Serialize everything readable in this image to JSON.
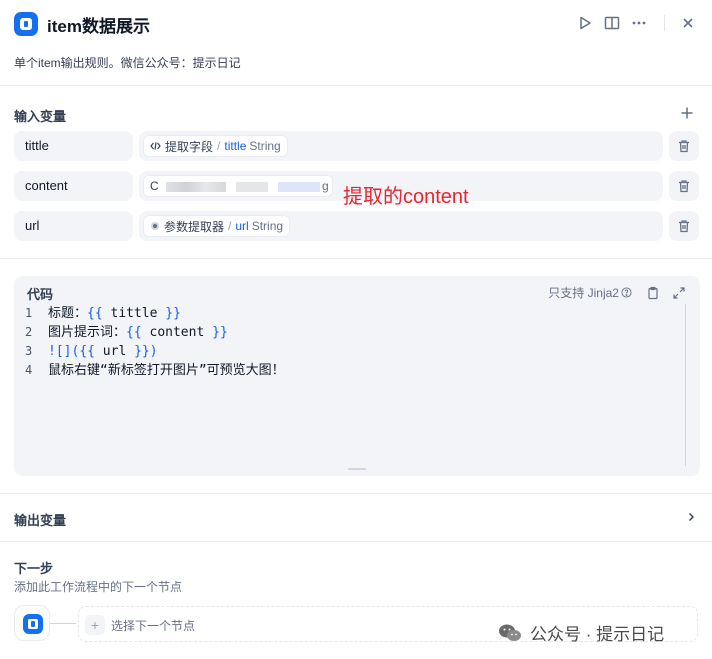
{
  "header": {
    "title": "item数据展示",
    "description": "单个item输出规则。微信公众号：提示日记"
  },
  "inputs": {
    "label": "输入变量",
    "rows": [
      {
        "name": "tittle",
        "source": "提取字段",
        "field": "tittle",
        "type": "String"
      },
      {
        "name": "content",
        "partial": "C",
        "partial_end": "g"
      },
      {
        "name": "url",
        "source": "参数提取器",
        "field": "url",
        "type": "String"
      }
    ],
    "annotation": "提取的content"
  },
  "code": {
    "label": "代码",
    "language_note": "只支持 Jinja2",
    "lines": [
      {
        "num": "1",
        "pre": "标题：",
        "open": "{{",
        "var": " tittle ",
        "close": "}}"
      },
      {
        "num": "2",
        "pre": "图片提示词：",
        "open": "{{",
        "var": " content ",
        "close": "}}"
      },
      {
        "num": "3",
        "pre": "![](",
        "open": "{{",
        "var": " url ",
        "close": "}})"
      },
      {
        "num": "4",
        "text": "鼠标右键“新标签打开图片”可预览大图！"
      }
    ]
  },
  "output": {
    "label": "输出变量"
  },
  "next": {
    "title": "下一步",
    "subtitle": "添加此工作流程中的下一个节点",
    "select_label": "选择下一个节点"
  },
  "watermark": {
    "text": "公众号 · 提示日记"
  },
  "colors": {
    "accent": "#1570ef",
    "annotation": "#e8252e",
    "token": "#155eef"
  }
}
